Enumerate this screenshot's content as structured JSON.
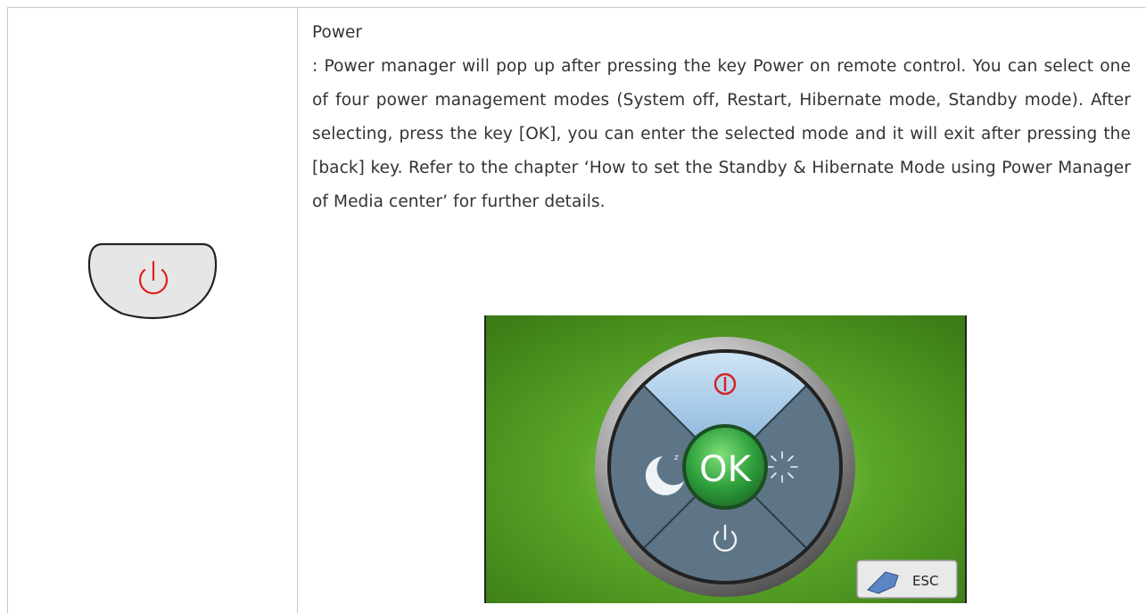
{
  "section": {
    "title": "Power",
    "description": ": Power manager will pop up after pressing the key Power on remote control. You can select one of four power management modes (System off, Restart, Hibernate mode, Standby mode). After selecting, press the key [OK], you can enter the selected mode and it will exit after pressing the [back] key. Refer to the chapter ‘How to set the Standby & Hibernate Mode using Power Manager of Media center’ for further details."
  },
  "remote_key": {
    "icon": "power-icon",
    "color": "#e02020"
  },
  "power_manager": {
    "center_label": "OK",
    "esc_label": "ESC",
    "colors": {
      "background": "#4f9a1e",
      "ring": "#9a9a9a",
      "center": "#35a845",
      "top_segment": "#7fb3e6"
    },
    "icons": [
      "system-off-icon",
      "restart-icon",
      "hibernate-icon",
      "standby-icon"
    ]
  }
}
